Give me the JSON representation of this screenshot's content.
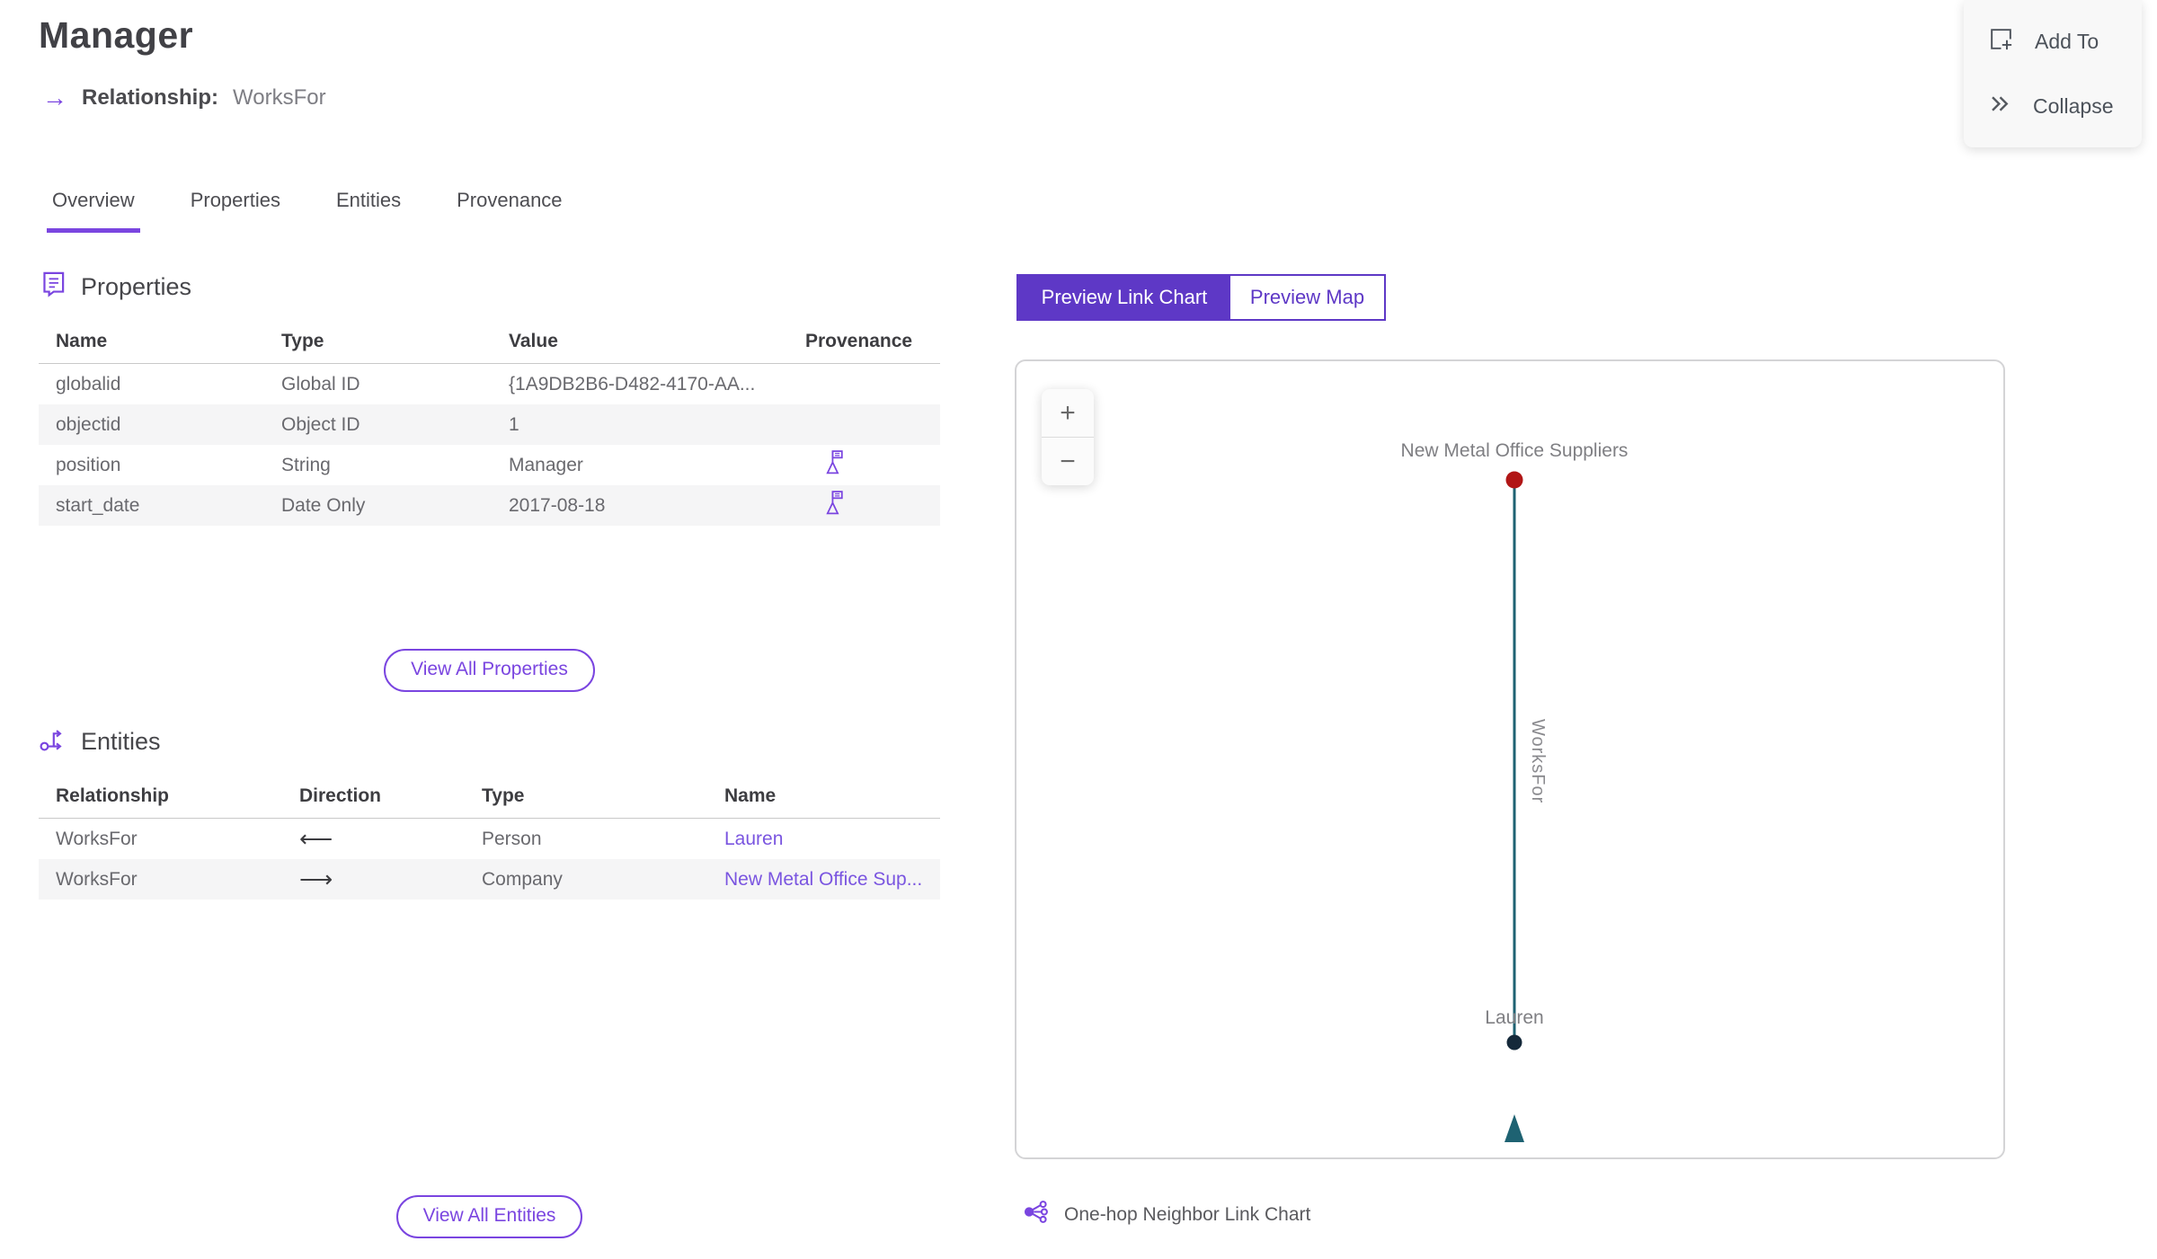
{
  "header": {
    "title": "Manager",
    "subtitle_label": "Relationship:",
    "subtitle_value": "WorksFor"
  },
  "icons": {
    "relationship_arrow": "→"
  },
  "actions": {
    "add_to": "Add To",
    "collapse": "Collapse"
  },
  "tabs": [
    {
      "label": "Overview",
      "active": true
    },
    {
      "label": "Properties",
      "active": false
    },
    {
      "label": "Entities",
      "active": false
    },
    {
      "label": "Provenance",
      "active": false
    }
  ],
  "properties": {
    "heading": "Properties",
    "columns": [
      "Name",
      "Type",
      "Value",
      "Provenance"
    ],
    "rows": [
      {
        "name": "globalid",
        "type": "Global ID",
        "value": "{1A9DB2B6-D482-4170-AA...",
        "has_provenance": false
      },
      {
        "name": "objectid",
        "type": "Object ID",
        "value": "1",
        "has_provenance": false
      },
      {
        "name": "position",
        "type": "String",
        "value": "Manager",
        "has_provenance": true
      },
      {
        "name": "start_date",
        "type": "Date Only",
        "value": "2017-08-18",
        "has_provenance": true
      }
    ],
    "view_all": "View All Properties"
  },
  "entities": {
    "heading": "Entities",
    "columns": [
      "Relationship",
      "Direction",
      "Type",
      "Name"
    ],
    "rows": [
      {
        "relationship": "WorksFor",
        "direction": "⟵",
        "type": "Person",
        "name": "Lauren"
      },
      {
        "relationship": "WorksFor",
        "direction": "⟶",
        "type": "Company",
        "name": "New Metal Office Sup..."
      }
    ],
    "view_all": "View All Entities"
  },
  "preview": {
    "toggle": [
      {
        "label": "Preview Link Chart",
        "selected": true
      },
      {
        "label": "Preview Map",
        "selected": false
      }
    ],
    "zoom_in": "+",
    "zoom_out": "−",
    "caption": "One-hop Neighbor Link Chart"
  },
  "chart_data": {
    "type": "node-link",
    "nodes": [
      {
        "label": "New Metal Office Suppliers",
        "color": "#b11616"
      },
      {
        "label": "Lauren",
        "color": "#15293a"
      }
    ],
    "edges": [
      {
        "label": "WorksFor",
        "from": "Lauren",
        "to": "New Metal Office Suppliers",
        "color": "#1e6272"
      }
    ]
  },
  "colors": {
    "accent": "#5e38c6",
    "accent_light": "#7a45e0",
    "node_red": "#b11616",
    "node_navy": "#15293a",
    "edge_teal": "#1e6272"
  }
}
